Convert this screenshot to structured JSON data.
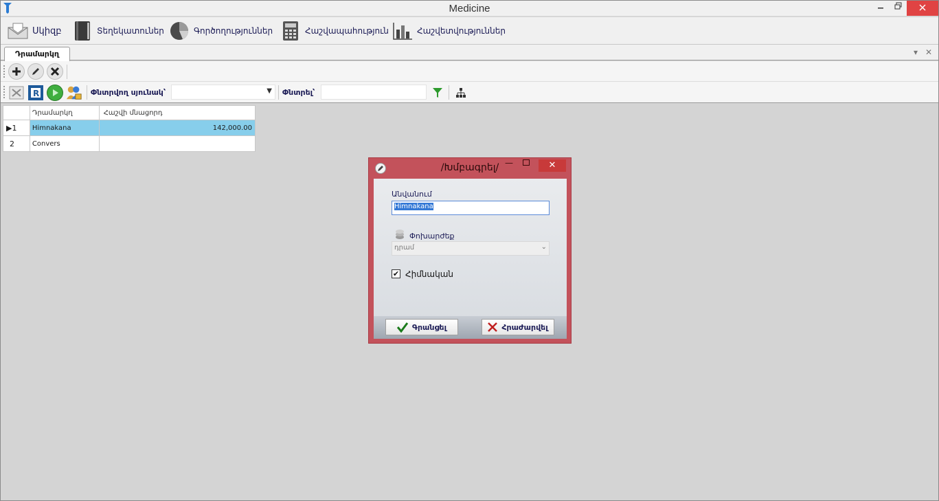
{
  "window": {
    "title": "Medicine"
  },
  "ribbon": {
    "items": [
      {
        "label": "Սկիզբ",
        "icon": "email-icon"
      },
      {
        "label": "Տեղեկատուներ",
        "icon": "book-icon"
      },
      {
        "label": "Գործողություններ",
        "icon": "pie-chart-icon"
      },
      {
        "label": "Հաշվապահություն",
        "icon": "calculator-icon"
      },
      {
        "label": "Հաշվետվություններ",
        "icon": "bar-chart-icon"
      }
    ]
  },
  "tabs": [
    {
      "label": "Դրամարկղ",
      "active": true
    }
  ],
  "toolbar": {
    "search_column_label": "Փնտրվող սյունակ՝",
    "search_column_value": "",
    "search_label": "Փնտրել՝",
    "search_value": ""
  },
  "grid": {
    "columns": [
      "Դրամարկղ",
      "Հաշվի մնացորդ"
    ],
    "rows": [
      {
        "num": "1",
        "name": "Himnakana",
        "balance": "142,000.00",
        "selected": true
      },
      {
        "num": "2",
        "name": "Convers",
        "balance": "",
        "selected": false
      }
    ]
  },
  "dialog": {
    "title": "/Խմբագրել/",
    "name_label": "Անվանում",
    "name_value": "Himnakana",
    "currency_label": "Փոխարժեք",
    "currency_value": "դրամ",
    "main_label": "Հիմնական",
    "main_checked": true,
    "save_label": "Գրանցել",
    "cancel_label": "Հրաժարվել"
  },
  "colors": {
    "selection": "#87ceeb",
    "dialog_frame": "#c3525b",
    "close_button": "#e04343"
  }
}
